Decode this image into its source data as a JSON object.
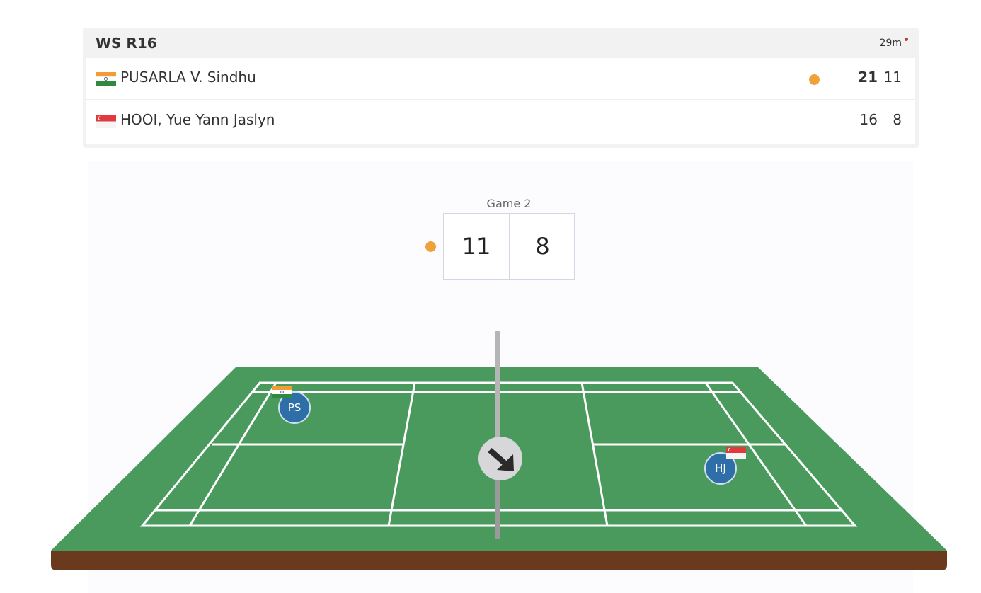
{
  "match": {
    "round": "WS R16",
    "duration": "29m",
    "live_indicator_color": "#c0392b"
  },
  "players": [
    {
      "name": "PUSARLA V. Sindhu",
      "country_flag": "india-flag-icon",
      "serving": true,
      "game_scores": [
        "21",
        "11"
      ],
      "initials": "PS"
    },
    {
      "name": "HOOI, Yue Yann Jaslyn",
      "country_flag": "singapore-flag-icon",
      "serving": false,
      "game_scores": [
        "16",
        "8"
      ],
      "initials": "HJ"
    }
  ],
  "current_game": {
    "label": "Game 2",
    "score_left": "11",
    "score_right": "8"
  },
  "colors": {
    "serve_indicator": "#f0a23a",
    "court_green": "#4a9a5e",
    "court_base": "#6b3a1e",
    "avatar_blue": "#2f6fa8"
  },
  "shuttle_icon": "arrow-down-right-icon"
}
